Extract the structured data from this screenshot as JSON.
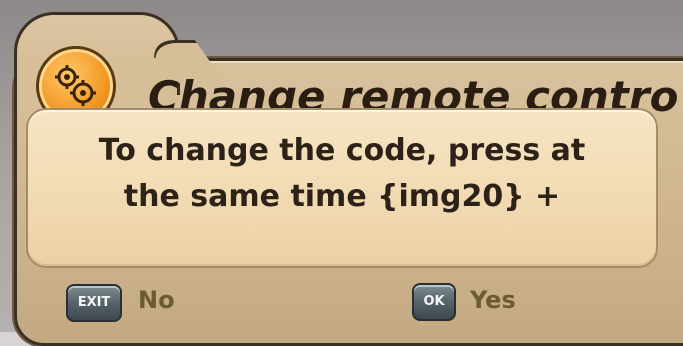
{
  "dialog": {
    "title": "Change remote contro",
    "message_line1": "To change the code, press at",
    "message_line2": "the same time {img20} +",
    "icon": "gear-icon"
  },
  "actions": {
    "exit_key": "EXIT",
    "no_label": "No",
    "ok_key": "OK",
    "yes_label": "Yes"
  },
  "colors": {
    "dialog_bg": "#cdb48c",
    "message_bg": "#f1dab2",
    "badge_orange": "#f39a27",
    "label_text": "#6b5b34"
  }
}
